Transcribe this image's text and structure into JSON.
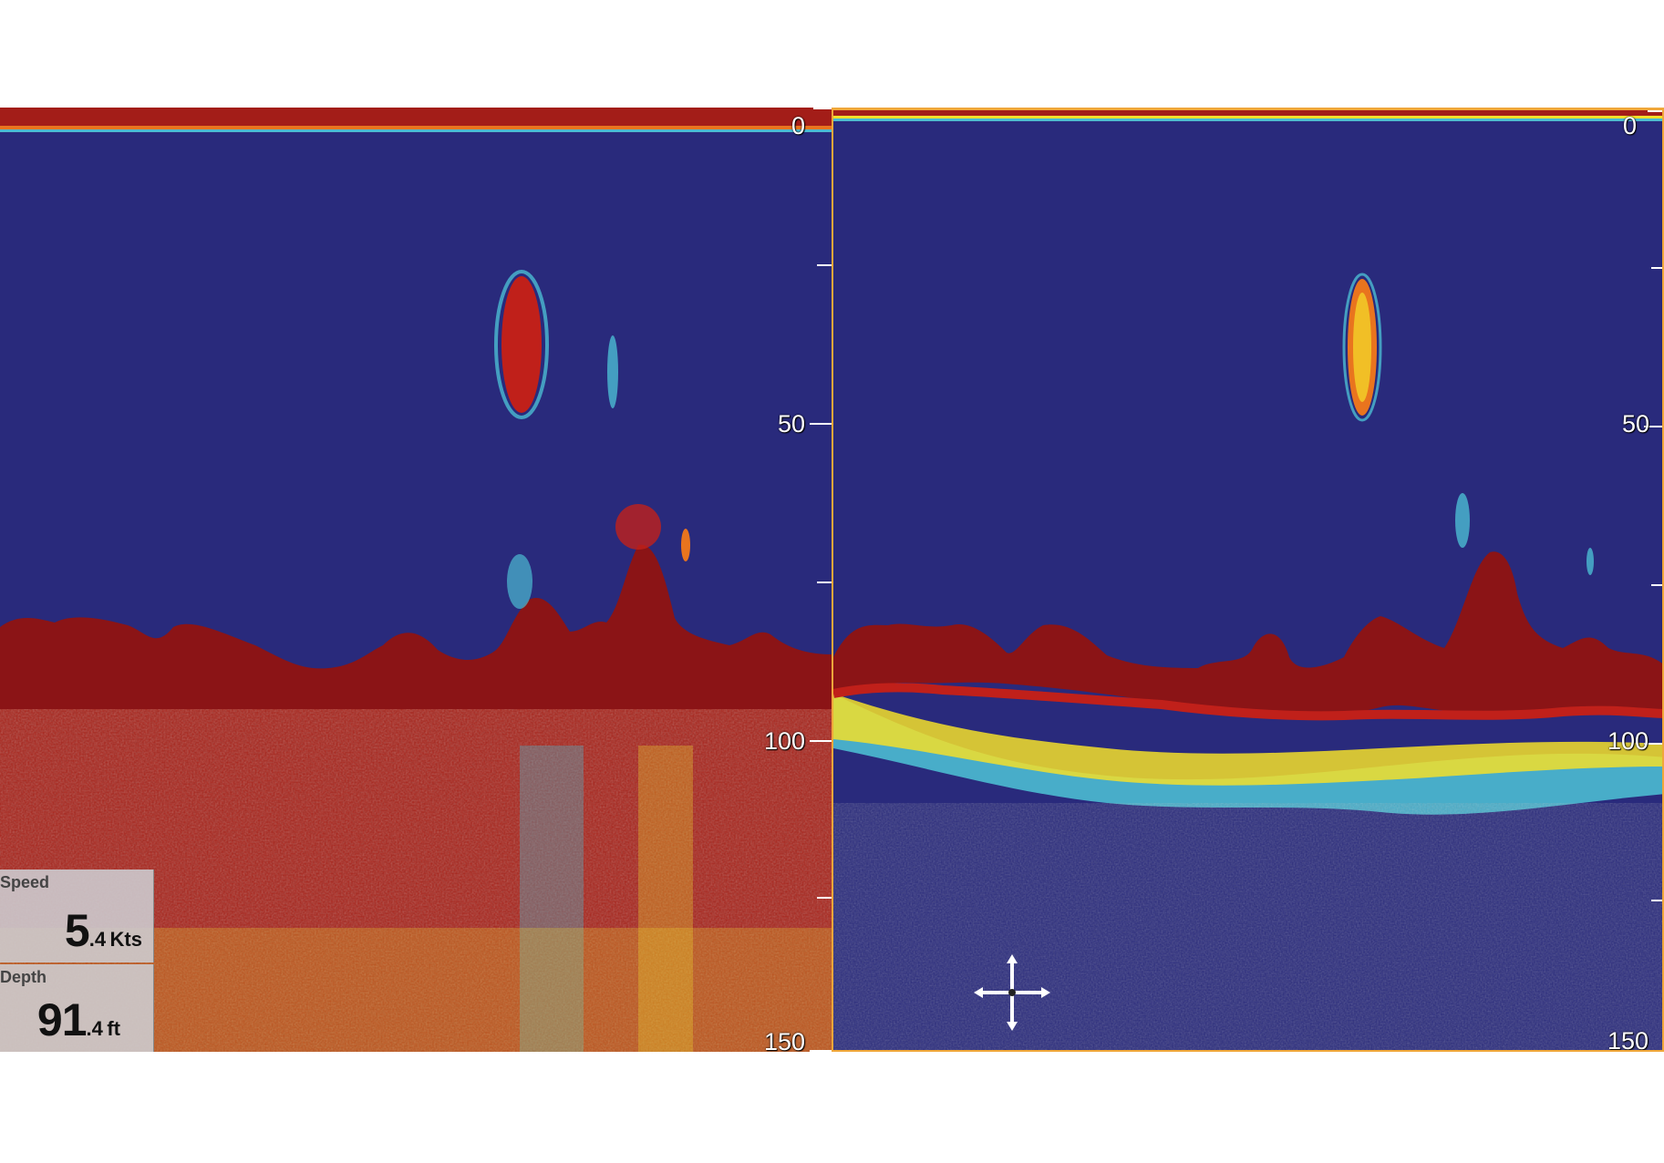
{
  "left_pane": {
    "scale_labels": [
      "0",
      "50",
      "100",
      "150"
    ]
  },
  "right_pane": {
    "scale_labels": [
      "0",
      "50",
      "100",
      "150"
    ]
  },
  "speed": {
    "title": "Speed",
    "int": "5",
    "dec": ".4",
    "unit": "Kts"
  },
  "depth": {
    "title": "Depth",
    "int": "91",
    "dec": ".4",
    "unit": "ft"
  },
  "colors": {
    "water": "#292a7c",
    "bottom": "#8b1416",
    "red": "#c0201a",
    "orange": "#e9741e",
    "yellow": "#f3df2a",
    "cyan": "#4bbbd2",
    "blue": "#2e55b5",
    "frame": "#f0a73a"
  },
  "icons": {
    "cursor": "move-crosshair-icon"
  }
}
